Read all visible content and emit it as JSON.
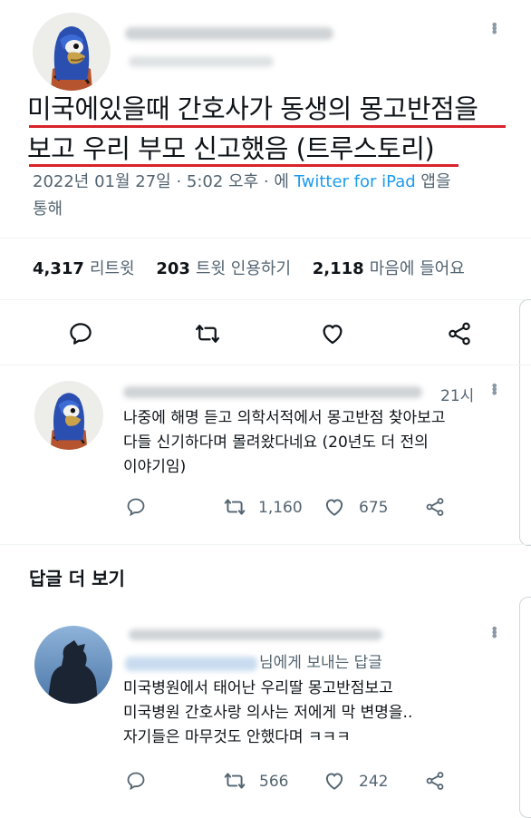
{
  "main_tweet": {
    "avatar": "bird-costume-avatar",
    "text_line1": "미국에있을때 간호사가 동생의 몽고반점을",
    "text_line2": "보고 우리 부모 신고했음 (트루스토리)",
    "meta_prefix": "2022년 01월 27일 · 5:02 오후 · 에 ",
    "meta_link": "Twitter for iPad",
    "meta_suffix": " 앱을",
    "meta_line2": "통해",
    "stats": {
      "retweets_value": "4,317",
      "retweets_label": "리트윗",
      "quotes_value": "203",
      "quotes_label": "트윗 인용하기",
      "likes_value": "2,118",
      "likes_label": "마음에 들어요"
    },
    "icons": [
      "reply-icon",
      "retweet-icon",
      "like-icon",
      "share-icon"
    ]
  },
  "reply1": {
    "time": "21시",
    "line1": "나중에 해명 듣고 의학서적에서 몽고반점 찾아보고",
    "line2": "다들 신기하다며 몰려왔다네요 (20년도 더 전의",
    "line3": "이야기임",
    "line3_end": ")",
    "retweets": "1,160",
    "likes": "675"
  },
  "more_replies_title": "답글 더 보기",
  "reply2": {
    "replying_to": "님에게 보내는 답글",
    "line1": "미국병원에서 태어난 우리딸 몽고반점보고",
    "line2": "미국병원 간호사랑 의사는 저에게 막 변명을..",
    "line3": "자기들은 마무것도 안했다며 ㅋㅋㅋ",
    "retweets": "566",
    "likes": "242"
  },
  "colors": {
    "link": "#1d9bf0",
    "muted": "#536471",
    "underline": "#d8232a"
  }
}
